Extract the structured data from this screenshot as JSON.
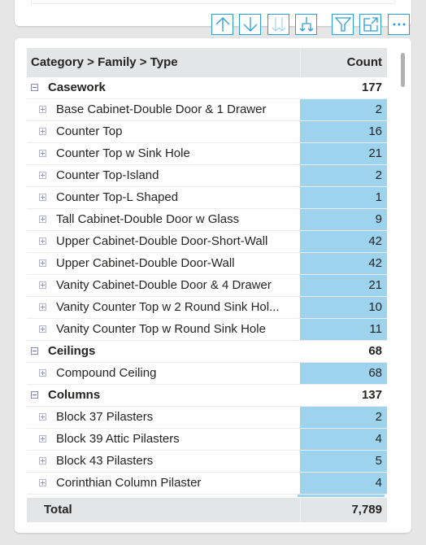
{
  "toolbar": {
    "buttons": [
      {
        "name": "drill-up",
        "icon": "arrow-up-icon"
      },
      {
        "name": "drill-down",
        "icon": "arrow-down-icon"
      },
      {
        "name": "go-to-next-level",
        "icon": "double-arrow-down-icon"
      },
      {
        "name": "expand-next-level",
        "icon": "fork-arrow-down-icon"
      },
      {
        "name": "filter",
        "icon": "filter-icon"
      },
      {
        "name": "focus-mode",
        "icon": "focus-mode-icon"
      },
      {
        "name": "more-options",
        "icon": "ellipsis-icon"
      }
    ]
  },
  "accent_color": "#2a9fd6",
  "bar_color": "#9dd3ec",
  "table": {
    "header": {
      "name": "Category > Family > Type",
      "count": "Count"
    },
    "groups": [
      {
        "category": "Casework",
        "count": "177",
        "items": [
          {
            "name": "Base Cabinet-Double Door & 1 Drawer",
            "count": "2"
          },
          {
            "name": "Counter Top",
            "count": "16"
          },
          {
            "name": "Counter Top w Sink Hole",
            "count": "21"
          },
          {
            "name": "Counter Top-Island",
            "count": "2"
          },
          {
            "name": "Counter Top-L Shaped",
            "count": "1"
          },
          {
            "name": "Tall Cabinet-Double Door w Glass",
            "count": "9"
          },
          {
            "name": "Upper Cabinet-Double Door-Short-Wall",
            "count": "42"
          },
          {
            "name": "Upper Cabinet-Double Door-Wall",
            "count": "42"
          },
          {
            "name": "Vanity Cabinet-Double Door & 4 Drawer",
            "count": "21"
          },
          {
            "name": "Vanity Counter Top w 2 Round Sink Hol...",
            "count": "10"
          },
          {
            "name": "Vanity Counter Top w Round Sink Hole",
            "count": "11"
          }
        ]
      },
      {
        "category": "Ceilings",
        "count": "68",
        "items": [
          {
            "name": "Compound Ceiling",
            "count": "68"
          }
        ]
      },
      {
        "category": "Columns",
        "count": "137",
        "items": [
          {
            "name": "Block 37 Pilasters",
            "count": "2"
          },
          {
            "name": "Block 39 Attic Pilasters",
            "count": "4"
          },
          {
            "name": "Block 43 Pilasters",
            "count": "5"
          },
          {
            "name": "Corinthian Column Pilaster",
            "count": "4"
          }
        ]
      }
    ],
    "total": {
      "label": "Total",
      "count": "7,789"
    }
  }
}
